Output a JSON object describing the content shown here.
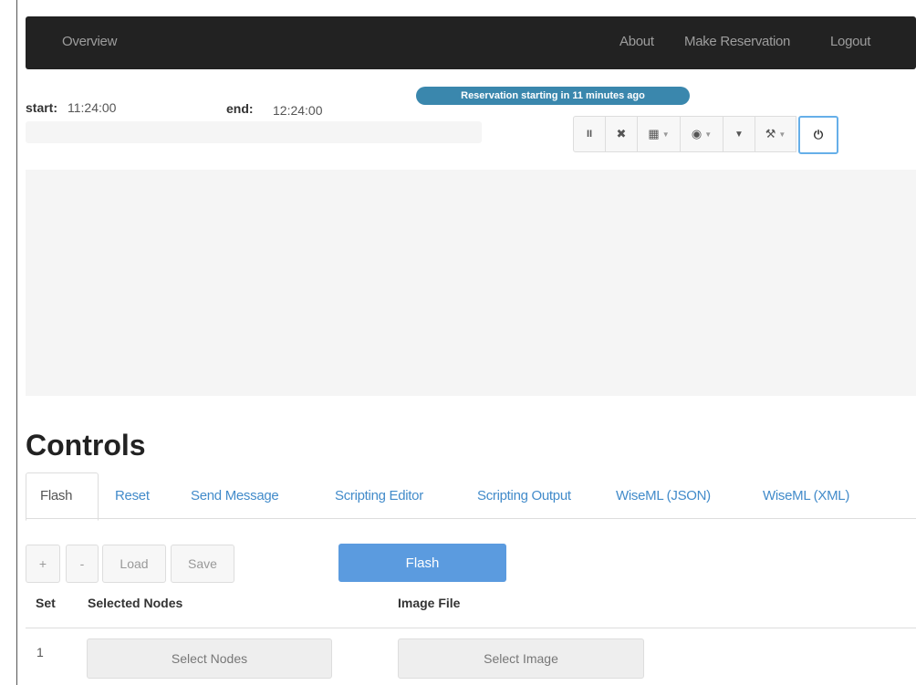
{
  "navbar": {
    "brand": "Overview",
    "links": [
      "About",
      "Make Reservation",
      "Logout"
    ]
  },
  "reservation": {
    "start_label": "start:",
    "start_time": "11:24:00",
    "end_label": "end:",
    "end_time": "12:24:00",
    "status_badge": "Reservation starting in 11 minutes ago"
  },
  "toolbar": {
    "icons": [
      "pause-icon",
      "clear-icon",
      "grid-icon",
      "eye-icon",
      "filter-icon",
      "wrench-icon",
      "power-icon"
    ],
    "glyphs": [
      "II",
      "✖",
      "▦",
      "◉",
      "▼",
      "⚒",
      "⏻"
    ]
  },
  "controls": {
    "heading": "Controls",
    "tabs": [
      "Flash",
      "Reset",
      "Send Message",
      "Scripting Editor",
      "Scripting Output",
      "WiseML (JSON)",
      "WiseML (XML)"
    ],
    "active_tab": "Flash",
    "buttons": {
      "add": "+",
      "remove": "-",
      "load": "Load",
      "save": "Save",
      "flash": "Flash"
    },
    "table": {
      "headers": [
        "Set",
        "Selected Nodes",
        "Image File"
      ],
      "rows": [
        {
          "set": "1",
          "nodes_button": "Select Nodes",
          "image_button": "Select Image"
        }
      ]
    }
  },
  "colors": {
    "navbar": "#222222",
    "accent": "#428bca",
    "badge": "#3a87ad",
    "flash_button": "#5b9bdf"
  }
}
